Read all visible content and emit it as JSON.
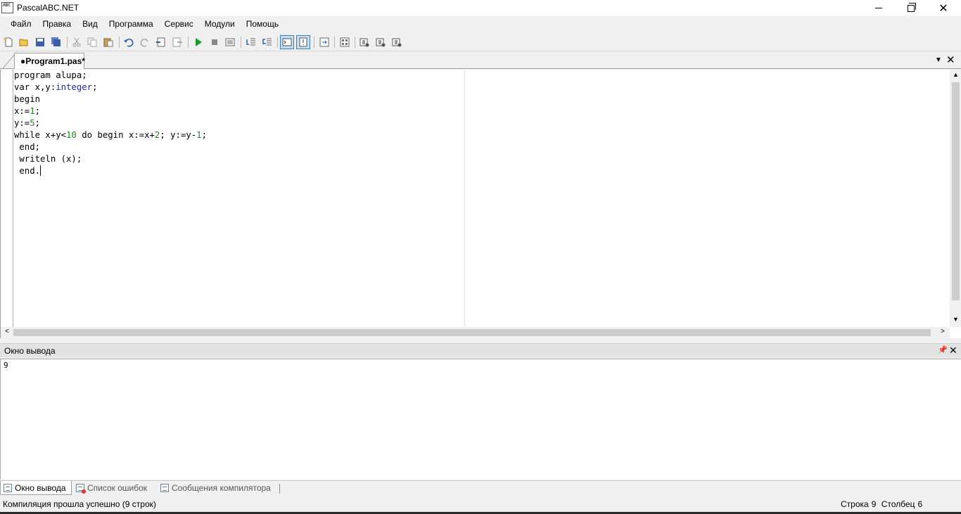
{
  "window": {
    "title": "PascalABC.NET",
    "icon": "pascalabc-app-icon",
    "icon_text": "ABC"
  },
  "menu": [
    "Файл",
    "Правка",
    "Вид",
    "Программа",
    "Сервис",
    "Модули",
    "Помощь"
  ],
  "toolbar": {
    "buttons": [
      "new-file-icon",
      "open-folder-icon",
      "save-icon",
      "save-all-icon",
      "cut-icon",
      "copy-icon",
      "paste-icon",
      "undo-icon",
      "redo-icon",
      "find-icon",
      "replace-icon",
      "run-icon",
      "stop-icon",
      "compile-icon",
      "step-into-icon",
      "step-over-icon",
      "output-toggle-icon",
      "errors-toggle-icon",
      "navigate-icon",
      "form-designer-icon",
      "tool-a-icon",
      "tool-b-icon",
      "tool-c-icon"
    ]
  },
  "editor": {
    "tab_label": "●Program1.pas*",
    "lines": [
      "program alupa;",
      "var x,y:integer;",
      "begin",
      "x:=1;",
      "y:=5;",
      "while x+y<10 do begin x:=x+2; y:=y-1;",
      " end;",
      " writeln (x);",
      " end."
    ]
  },
  "output": {
    "title": "Окно вывода",
    "text": "9"
  },
  "bottom_tabs": [
    {
      "label": "Окно вывода",
      "active": true
    },
    {
      "label": "Список ошибок",
      "active": false
    },
    {
      "label": "Сообщения компилятора",
      "active": false
    }
  ],
  "status": {
    "message": "Компиляция прошла успешно (9 строк)",
    "row_label": "Строка",
    "row_value": "9",
    "col_label": "Столбец",
    "col_value": "6"
  },
  "colors": {
    "keyword_type": "#1c2ba7",
    "number": "#1a8b1a",
    "active_tool": "#c4def6"
  }
}
